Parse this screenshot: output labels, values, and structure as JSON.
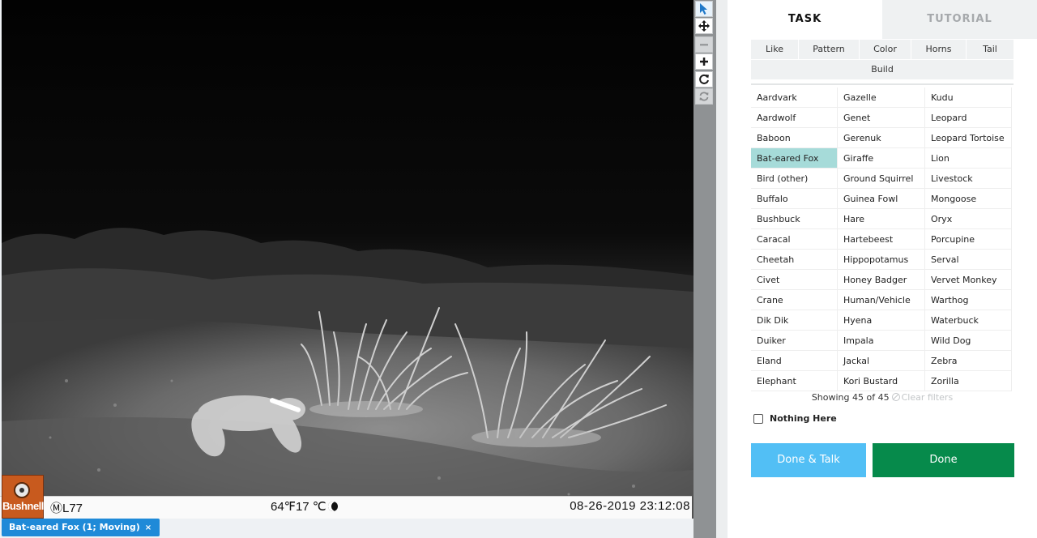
{
  "viewer": {
    "camera_brand": "Bushnell",
    "camera_id": "ⓂL77",
    "temperature": "64℉17 ℃",
    "timestamp": "08-26-2019 23:12:08",
    "annotation_chip": "Bat-eared Fox (1; Moving)",
    "annotation_remove": "×"
  },
  "toolbar": {
    "tools": [
      "pointer-icon",
      "move-icon",
      "zoom-out-icon",
      "zoom-in-icon",
      "rotate-icon",
      "reset-icon"
    ]
  },
  "panel": {
    "tabs": {
      "task": "TASK",
      "tutorial": "TUTORIAL"
    },
    "filters": [
      "Like",
      "Pattern",
      "Color",
      "Horns",
      "Tail"
    ],
    "filter_second_row": "Build",
    "species": [
      "Aardvark",
      "Gazelle",
      "Kudu",
      "Aardwolf",
      "Genet",
      "Leopard",
      "Baboon",
      "Gerenuk",
      "Leopard Tortoise",
      "Bat-eared Fox",
      "Giraffe",
      "Lion",
      "Bird (other)",
      "Ground Squirrel",
      "Livestock",
      "Buffalo",
      "Guinea Fowl",
      "Mongoose",
      "Bushbuck",
      "Hare",
      "Oryx",
      "Caracal",
      "Hartebeest",
      "Porcupine",
      "Cheetah",
      "Hippopotamus",
      "Serval",
      "Civet",
      "Honey Badger",
      "Vervet Monkey",
      "Crane",
      "Human/Vehicle",
      "Warthog",
      "Dik Dik",
      "Hyena",
      "Waterbuck",
      "Duiker",
      "Impala",
      "Wild Dog",
      "Eland",
      "Jackal",
      "Zebra",
      "Elephant",
      "Kori Bustard",
      "Zorilla"
    ],
    "selected_species": "Bat-eared Fox",
    "showing": "Showing 45 of 45",
    "clear_filters": "Clear filters",
    "nothing_here": "Nothing Here",
    "done_talk": "Done & Talk",
    "done": "Done"
  },
  "colors": {
    "selected_cell": "#a6dbd9",
    "done_talk_button": "#52bff5",
    "done_button": "#068a4b",
    "chip": "#1f8ad8"
  }
}
